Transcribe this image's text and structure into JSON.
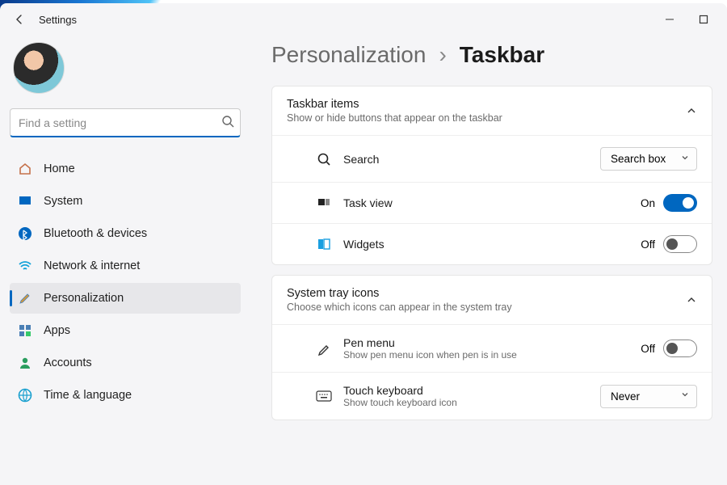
{
  "window": {
    "title": "Settings"
  },
  "search": {
    "placeholder": "Find a setting"
  },
  "nav": {
    "items": [
      {
        "label": "Home"
      },
      {
        "label": "System"
      },
      {
        "label": "Bluetooth & devices"
      },
      {
        "label": "Network & internet"
      },
      {
        "label": "Personalization"
      },
      {
        "label": "Apps"
      },
      {
        "label": "Accounts"
      },
      {
        "label": "Time & language"
      }
    ],
    "active_index": 4
  },
  "breadcrumb": {
    "parent": "Personalization",
    "separator": "›",
    "current": "Taskbar"
  },
  "groups": [
    {
      "title": "Taskbar items",
      "subtitle": "Show or hide buttons that appear on the taskbar",
      "rows": [
        {
          "label": "Search",
          "control": "dropdown",
          "value": "Search box"
        },
        {
          "label": "Task view",
          "control": "toggle",
          "state_label": "On",
          "on": true
        },
        {
          "label": "Widgets",
          "control": "toggle",
          "state_label": "Off",
          "on": false
        }
      ]
    },
    {
      "title": "System tray icons",
      "subtitle": "Choose which icons can appear in the system tray",
      "rows": [
        {
          "label": "Pen menu",
          "sublabel": "Show pen menu icon when pen is in use",
          "control": "toggle",
          "state_label": "Off",
          "on": false
        },
        {
          "label": "Touch keyboard",
          "sublabel": "Show touch keyboard icon",
          "control": "dropdown",
          "value": "Never"
        }
      ]
    }
  ]
}
